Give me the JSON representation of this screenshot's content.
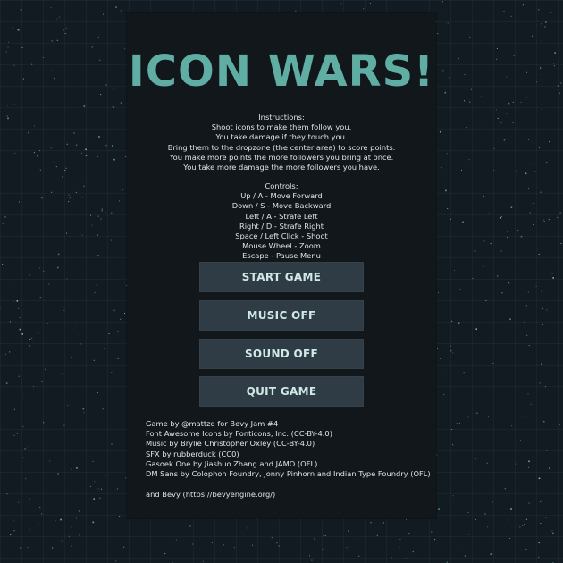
{
  "title": "ICON WARS!",
  "instructions": {
    "heading": "Instructions:",
    "lines": [
      "Shoot icons to make them follow you.",
      "You take damage if they touch you.",
      "Bring them to the dropzone (the center area) to score points.",
      "You make more points the more followers you bring at once.",
      "You take more damage the more followers you have."
    ]
  },
  "controls": {
    "heading": "Controls:",
    "lines": [
      "Up / A - Move Forward",
      "Down / S - Move Backward",
      "Left / A - Strafe Left",
      "Right / D - Strafe Right",
      "Space / Left Click - Shoot",
      "Mouse Wheel - Zoom",
      "Escape - Pause Menu"
    ]
  },
  "menu": {
    "start": "START GAME",
    "music": "MUSIC OFF",
    "sound": "SOUND OFF",
    "quit": "QUIT GAME"
  },
  "credits": {
    "lines": [
      "Game by @mattzq for Bevy Jam #4",
      "Font Awesome Icons by Fonticons, Inc. (CC-BY-4.0)",
      "Music by Brylie Christopher Oxley (CC-BY-4.0)",
      "SFX by rubberduck (CC0)",
      "Gasoek One by Jiashuo Zhang and JAMO (OFL)",
      "DM Sans by Colophon Foundry, Jonny Pinhorn and Indian Type Foundry (OFL)"
    ],
    "bevy": "and Bevy (https://bevyengine.org/)"
  },
  "colors": {
    "title": "#5fada3",
    "panel": "#12171c",
    "button": "#303c45",
    "background": "#121b22",
    "star": "#8fd3c8"
  }
}
